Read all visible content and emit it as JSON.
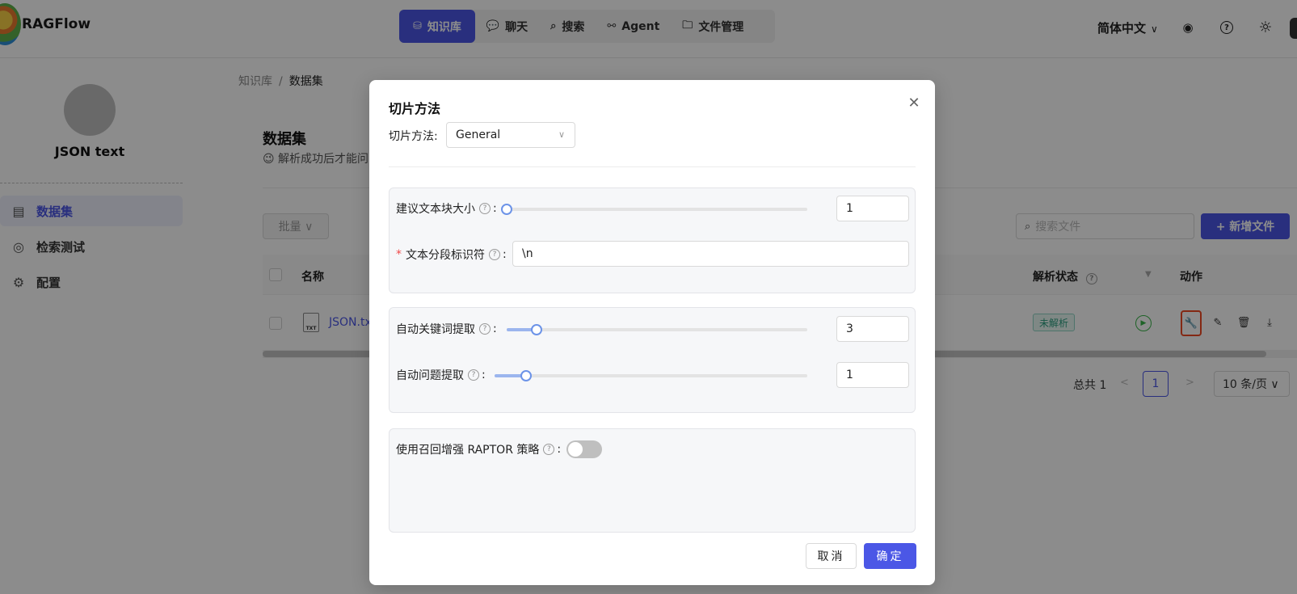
{
  "app": {
    "brand": "RAGFlow"
  },
  "nav": {
    "items": [
      {
        "label": "知识库",
        "icon": "database-icon",
        "glyph": "⛁",
        "active": true
      },
      {
        "label": "聊天",
        "icon": "chat-icon",
        "glyph": "💬",
        "active": false
      },
      {
        "label": "搜索",
        "icon": "search-icon",
        "glyph": "⌕",
        "active": false
      },
      {
        "label": "Agent",
        "icon": "agent-icon",
        "glyph": "⚯",
        "active": false
      },
      {
        "label": "文件管理",
        "icon": "folder-icon",
        "glyph": "🗀",
        "active": false
      }
    ]
  },
  "header": {
    "language": "简体中文",
    "chevron": "∨",
    "github_glyph": "◉",
    "help_glyph": "?",
    "theme_glyph": "☼"
  },
  "sidebar": {
    "kb_name": "JSON text",
    "items": [
      {
        "label": "数据集",
        "icon": "dataset-icon",
        "glyph": "▤",
        "active": true
      },
      {
        "label": "检索测试",
        "icon": "retrieval-test-icon",
        "glyph": "◎",
        "active": false
      },
      {
        "label": "配置",
        "icon": "settings-icon",
        "glyph": "⚙",
        "active": false
      }
    ]
  },
  "breadcrumb": {
    "root": "知识库",
    "separator": "/",
    "current": "数据集"
  },
  "main": {
    "title": "数据集",
    "description": "😉 解析成功后才能问",
    "batch_label": "批量 ∨",
    "search_placeholder": "搜索文件",
    "search_glyph": "⌕",
    "add_file_label": "+ 新增文件",
    "columns": {
      "name": "名称",
      "parse_status": "解析状态",
      "action": "动作"
    },
    "filter_glyph": "▼",
    "row": {
      "file_type": "TXT",
      "file_name": "JSON.tx",
      "status": "未解析",
      "run_glyph": "▶"
    },
    "actions": {
      "settings_glyph": "🔧",
      "edit_glyph": "✎",
      "delete_glyph": "🗑",
      "download_glyph": "⤓"
    },
    "pagination": {
      "total": "总共 1",
      "prev": "<",
      "next": ">",
      "current_page": "1",
      "page_size": "10 条/页 ∨"
    }
  },
  "modal": {
    "title": "切片方法",
    "close_glyph": "✕",
    "method_label": "切片方法:",
    "method_value": "General",
    "method_chevron": "∨",
    "fields": {
      "chunk_size": {
        "label": "建议文本块大小",
        "value": "1",
        "level": 0.0
      },
      "delimiter": {
        "label": "文本分段标识符",
        "required_mark": "*",
        "value": "\\n"
      },
      "auto_keywords": {
        "label": "自动关键词提取",
        "value": "3",
        "level": 0.1
      },
      "auto_questions": {
        "label": "自动问题提取",
        "value": "1",
        "level": 0.1
      },
      "raptor": {
        "label": "使用召回增强 RAPTOR 策略",
        "enabled": false
      }
    },
    "help_glyph": "?",
    "colon": ":",
    "cancel_label": "取消",
    "ok_label": "确定"
  },
  "colors": {
    "accent": "#4b57e6",
    "highlight": "#f04a23",
    "status_green": "#2a9d7f"
  }
}
